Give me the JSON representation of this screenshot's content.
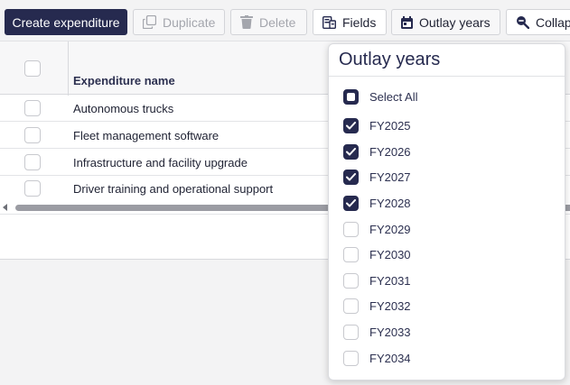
{
  "toolbar": {
    "create_label": "Create expenditure",
    "duplicate_label": "Duplicate",
    "delete_label": "Delete",
    "fields_label": "Fields",
    "outlay_label": "Outlay years",
    "collapse_label": "Collap"
  },
  "table": {
    "column_header": "Expenditure name",
    "rows": [
      {
        "name": "Autonomous trucks"
      },
      {
        "name": "Fleet management software"
      },
      {
        "name": "Infrastructure and facility upgrade"
      },
      {
        "name": "Driver training and operational support"
      }
    ]
  },
  "outlay_popup": {
    "title": "Outlay years",
    "select_all_label": "Select All",
    "select_all_state": "partial",
    "years": [
      {
        "label": "FY2025",
        "checked": true
      },
      {
        "label": "FY2026",
        "checked": true
      },
      {
        "label": "FY2027",
        "checked": true
      },
      {
        "label": "FY2028",
        "checked": true
      },
      {
        "label": "FY2029",
        "checked": false
      },
      {
        "label": "FY2030",
        "checked": false
      },
      {
        "label": "FY2031",
        "checked": false
      },
      {
        "label": "FY2032",
        "checked": false
      },
      {
        "label": "FY2033",
        "checked": false
      },
      {
        "label": "FY2034",
        "checked": false
      }
    ]
  },
  "colors": {
    "primary": "#262a4f",
    "disabled_text": "#a4a6ad",
    "border": "#d3d4d8"
  }
}
